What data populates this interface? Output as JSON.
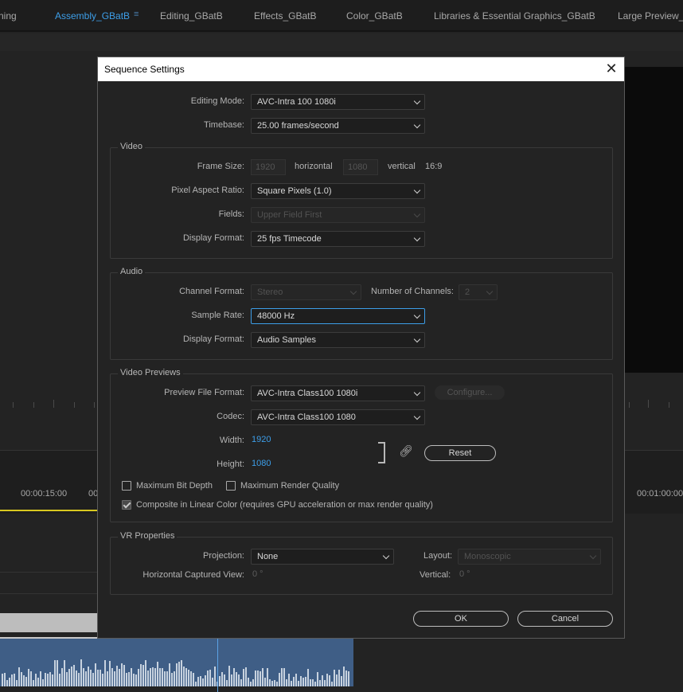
{
  "workspace": {
    "tabs": [
      {
        "label": "ning",
        "active": false
      },
      {
        "label": "Assembly_GBatB",
        "active": true
      },
      {
        "label": "Editing_GBatB",
        "active": false
      },
      {
        "label": "Effects_GBatB",
        "active": false
      },
      {
        "label": "Color_GBatB",
        "active": false
      },
      {
        "label": "Libraries & Essential Graphics_GBatB",
        "active": false
      },
      {
        "label": "Large Preview_GBatB",
        "active": false
      }
    ],
    "menu_icon": "≡"
  },
  "timeline": {
    "timecodes": [
      "00:00:15:00",
      "00",
      "00:01:00:00"
    ]
  },
  "dialog": {
    "title": "Sequence Settings",
    "close_glyph": "✕",
    "editing_mode_label": "Editing Mode:",
    "editing_mode_value": "AVC-Intra 100 1080i",
    "timebase_label": "Timebase:",
    "timebase_value": "25.00  frames/second",
    "video": {
      "title": "Video",
      "frame_size_label": "Frame Size:",
      "width_value": "1920",
      "horizontal_label": "horizontal",
      "height_value": "1080",
      "vertical_label": "vertical",
      "aspect": "16:9",
      "pixel_aspect_label": "Pixel Aspect Ratio:",
      "pixel_aspect_value": "Square Pixels (1.0)",
      "fields_label": "Fields:",
      "fields_value": "Upper Field First",
      "display_format_label": "Display Format:",
      "display_format_value": "25 fps Timecode"
    },
    "audio": {
      "title": "Audio",
      "channel_format_label": "Channel Format:",
      "channel_format_value": "Stereo",
      "num_channels_label": "Number of Channels:",
      "num_channels_value": "2",
      "sample_rate_label": "Sample Rate:",
      "sample_rate_value": "48000 Hz",
      "display_format_label": "Display Format:",
      "display_format_value": "Audio Samples"
    },
    "previews": {
      "title": "Video Previews",
      "file_format_label": "Preview File Format:",
      "file_format_value": "AVC-Intra Class100 1080i",
      "configure_label": "Configure...",
      "codec_label": "Codec:",
      "codec_value": "AVC-Intra Class100 1080",
      "width_label": "Width:",
      "width_value": "1920",
      "height_label": "Height:",
      "height_value": "1080",
      "reset_label": "Reset",
      "max_bit_depth_label": "Maximum Bit Depth",
      "max_bit_depth_checked": false,
      "max_render_quality_label": "Maximum Render Quality",
      "max_render_quality_checked": false,
      "composite_label": "Composite in Linear Color (requires GPU acceleration or max render quality)",
      "composite_checked": true
    },
    "vr": {
      "title": "VR Properties",
      "projection_label": "Projection:",
      "projection_value": "None",
      "layout_label": "Layout:",
      "layout_value": "Monoscopic",
      "h_captured_label": "Horizontal Captured View:",
      "h_captured_value": "0 °",
      "vertical_label": "Vertical:",
      "vertical_value": "0 °"
    },
    "ok_label": "OK",
    "cancel_label": "Cancel"
  }
}
